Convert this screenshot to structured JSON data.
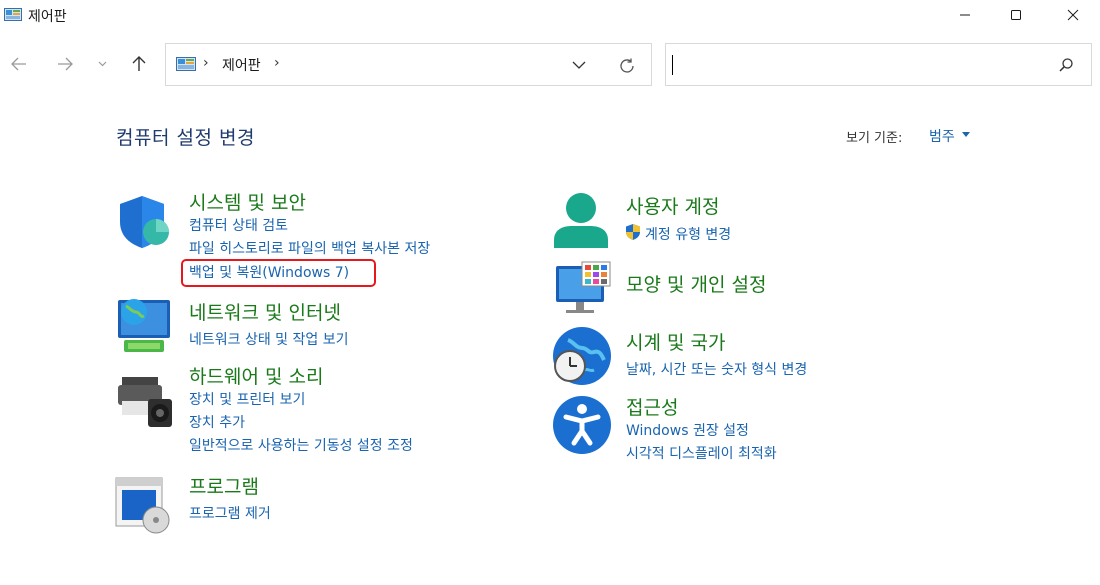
{
  "window": {
    "title": "제어판"
  },
  "address": {
    "path_item": "제어판",
    "separator": "›",
    "search_placeholder": ""
  },
  "header": {
    "title": "컴퓨터 설정 변경",
    "view_by_label": "보기 기준:",
    "view_by_value": "범주"
  },
  "categories": {
    "system_security": {
      "title": "시스템 및 보안",
      "links": [
        "컴퓨터 상태 검토",
        "파일 히스토리로 파일의 백업 복사본 저장",
        "백업 및 복원(Windows 7)"
      ]
    },
    "network": {
      "title": "네트워크 및 인터넷",
      "links": [
        "네트워크 상태 및 작업 보기"
      ]
    },
    "hardware": {
      "title": "하드웨어 및 소리",
      "links": [
        "장치 및 프린터 보기",
        "장치 추가",
        "일반적으로 사용하는 기동성 설정 조정"
      ]
    },
    "programs": {
      "title": "프로그램",
      "links": [
        "프로그램 제거"
      ]
    },
    "user_accounts": {
      "title": "사용자 계정",
      "links": [
        "계정 유형 변경"
      ]
    },
    "appearance": {
      "title": "모양 및 개인 설정",
      "links": []
    },
    "clock_region": {
      "title": "시계 및 국가",
      "links": [
        "날짜, 시간 또는 숫자 형식 변경"
      ]
    },
    "accessibility": {
      "title": "접근성",
      "links": [
        "Windows 권장 설정",
        "시각적 디스플레이 최적화"
      ]
    }
  },
  "colors": {
    "category_title": "#1a7a1a",
    "link": "#1a64b0",
    "page_title": "#1e3a6e",
    "highlight": "#e5191d"
  }
}
